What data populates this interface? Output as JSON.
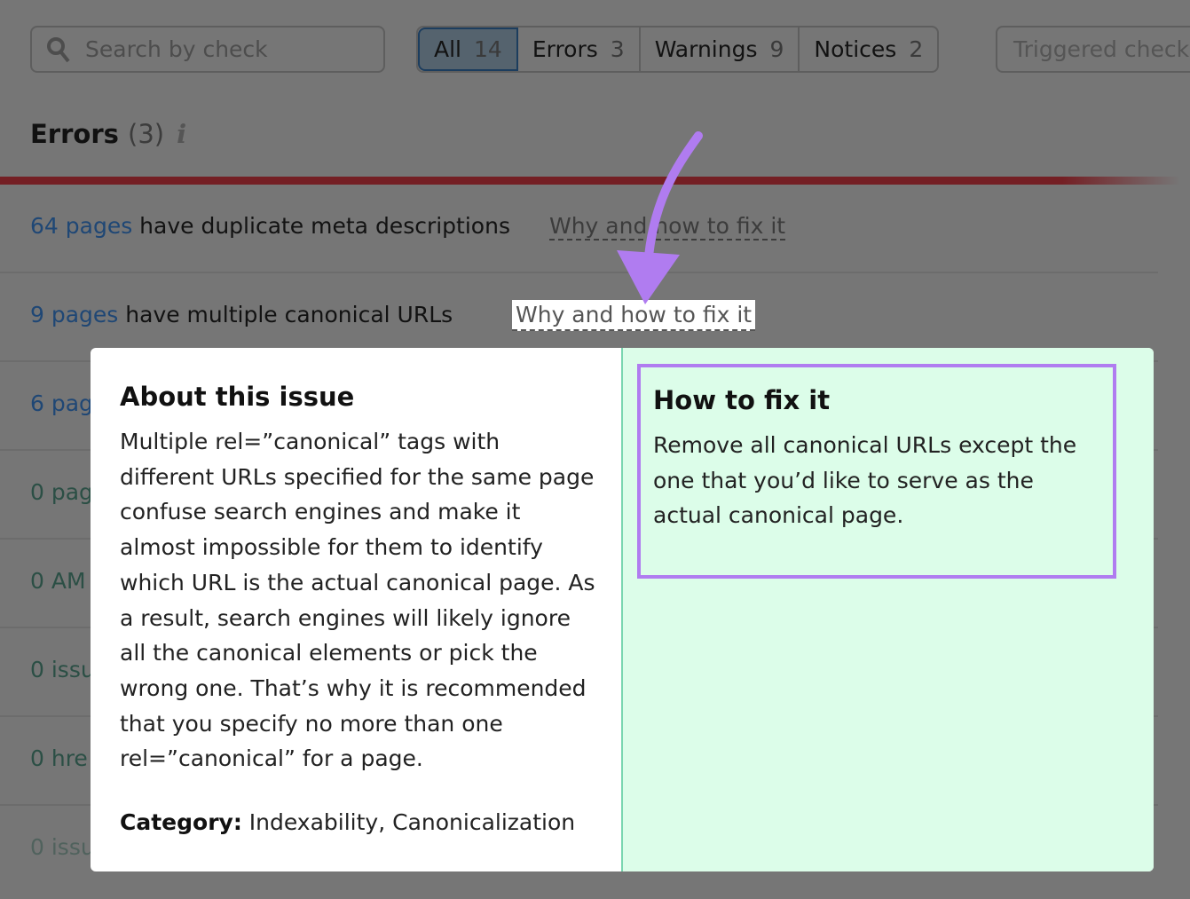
{
  "search": {
    "placeholder": "Search by check"
  },
  "filters": [
    {
      "label": "All",
      "count": "14"
    },
    {
      "label": "Errors",
      "count": "3"
    },
    {
      "label": "Warnings",
      "count": "9"
    },
    {
      "label": "Notices",
      "count": "2"
    }
  ],
  "triggered": "Triggered checks",
  "section": {
    "title": "Errors",
    "count": "(3)",
    "info": "i"
  },
  "rows": [
    {
      "count": "64 pages",
      "text": " have duplicate meta descriptions",
      "why": "Why and how to fix it"
    },
    {
      "count": "9 pages",
      "text": " have multiple canonical URLs",
      "why": "Why and how to fix it"
    },
    {
      "count": "6 pag"
    },
    {
      "count": "0 pag"
    },
    {
      "count": "0 AM"
    },
    {
      "count": "0 issu"
    },
    {
      "count": "0 hre"
    },
    {
      "count": "0 issu"
    }
  ],
  "popup": {
    "about_title": "About this issue",
    "about_text": "Multiple rel=”canonical” tags with different URLs specified for the same page confuse search engines and make it almost impossible for them to identify which URL is the actual canonical page. As a result, search engines will likely ignore all the canonical elements or pick the wrong one. That’s why it is recommended that you specify no more than one rel=”canonical” for a page.",
    "category_label": "Category:",
    "category_value": " Indexability, Canonicalization",
    "fix_title": "How to fix it",
    "fix_text": "Remove all canonical URLs except the one that you’d like to serve as the actual canonical page."
  },
  "colors": {
    "accent_arrow": "#b07cf0",
    "error_bar": "#741f24",
    "fix_bg": "#dcfde9"
  }
}
